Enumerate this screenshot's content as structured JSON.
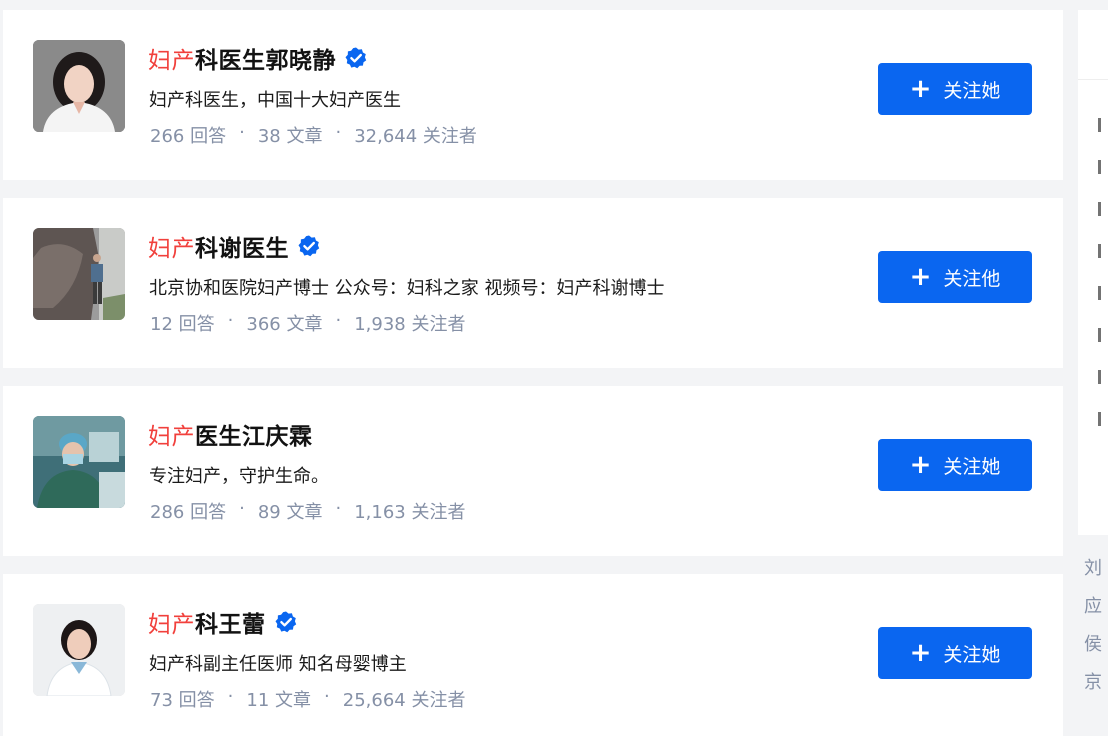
{
  "users": [
    {
      "name_highlight": "妇产",
      "name_rest": "科医生郭晓静",
      "verified": true,
      "bio": "妇产科医生，中国十大妇产医生",
      "answers": "266 回答",
      "articles": "38 文章",
      "followers": "32,644 关注者",
      "follow_label": "关注她",
      "avatar_icon": "doctor-portrait-woman"
    },
    {
      "name_highlight": "妇产",
      "name_rest": "科谢医生",
      "verified": true,
      "bio": "北京协和医院妇产博士 公众号：妇科之家 视频号：妇产科谢博士",
      "answers": "12 回答",
      "articles": "366 文章",
      "followers": "1,938 关注者",
      "follow_label": "关注他",
      "avatar_icon": "street-photo"
    },
    {
      "name_highlight": "妇产",
      "name_rest": "医生江庆霖",
      "verified": false,
      "bio": "专注妇产，守护生命。",
      "answers": "286 回答",
      "articles": "89 文章",
      "followers": "1,163 关注者",
      "follow_label": "关注她",
      "avatar_icon": "surgeon-photo"
    },
    {
      "name_highlight": "妇产",
      "name_rest": "科王蕾",
      "verified": true,
      "bio": "妇产科副主任医师 知名母婴博主",
      "answers": "73 回答",
      "articles": "11 文章",
      "followers": "25,664 关注者",
      "follow_label": "关注她",
      "avatar_icon": "doctor-portrait-woman"
    }
  ],
  "separator": "·",
  "plus_glyph": "+",
  "side_names": [
    "刘",
    "应",
    "侯",
    "京"
  ],
  "colors": {
    "highlight": "#f1403c",
    "button": "#0a66f0",
    "verified": "#0a66f0",
    "meta": "#8590a6"
  }
}
